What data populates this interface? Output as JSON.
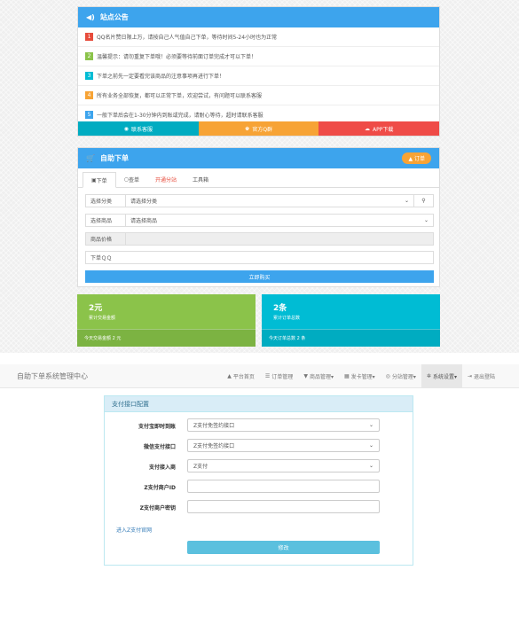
{
  "notice": {
    "title": "站点公告",
    "items": [
      {
        "num": "1",
        "color": "#e74c3c",
        "text": "QQ名片赞日限上万，请按自己人气值自己下单，等待时间5-24小时也为正常"
      },
      {
        "num": "2",
        "color": "#8bc34a",
        "text": "温馨提示：请勿重复下单哦！必须要等待前面订单完成才可以下单！"
      },
      {
        "num": "3",
        "color": "#00bcd4",
        "text": "下单之前先一定要看完该商品的注意事项再进行下单！"
      },
      {
        "num": "4",
        "color": "#f7a335",
        "text": "所有业务全部恢复，都可以正常下单，欢迎尝试，有问题可以联系客服"
      },
      {
        "num": "5",
        "color": "#3da4ed",
        "text": "一般下单后会在1-30分钟内到账或完成，请耐心等待，超时请联系客服"
      }
    ],
    "buttons": [
      {
        "label": "联系客服",
        "color": "#00acc1",
        "icon": "◉"
      },
      {
        "label": "官方Q群",
        "color": "#f7a335",
        "icon": "♚"
      },
      {
        "label": "APP下载",
        "color": "#ef4b47",
        "icon": "☁"
      }
    ]
  },
  "order": {
    "title": "自助下单",
    "badge": "订单",
    "tabs": [
      "下单",
      "查单",
      "开通分站",
      "工具箱"
    ],
    "category_label": "选择分类",
    "category_value": "请选择分类",
    "product_label": "选择商品",
    "product_value": "请选择商品",
    "price_label": "商品价格",
    "qq_label": "下单ＱＱ",
    "buy_label": "立即购买"
  },
  "stats": [
    {
      "big": "2元",
      "sub": "累计交易金额",
      "foot": "今天交易金额 2 元",
      "color": "#8bc34a",
      "footColor": "#7cb342"
    },
    {
      "big": "2条",
      "sub": "累计订单总数",
      "foot": "今天订单总数 2 条",
      "color": "#00bcd4",
      "footColor": "#00acc1"
    }
  ],
  "admin": {
    "brand": "自助下单系统管理中心",
    "nav": [
      {
        "icon": "▲",
        "label": "平台首页"
      },
      {
        "icon": "☰",
        "label": "订单管理"
      },
      {
        "icon": "▼",
        "label": "商品管理▾"
      },
      {
        "icon": "▦",
        "label": "发卡管理▾"
      },
      {
        "icon": "◎",
        "label": "分站管理▾"
      },
      {
        "icon": "✲",
        "label": "系统设置▾"
      },
      {
        "icon": "⇥",
        "label": "退出登陆"
      }
    ],
    "panel_title": "支付接口配置",
    "fields": [
      {
        "label": "支付宝即时到账",
        "value": "Z支付免签约接口",
        "type": "select"
      },
      {
        "label": "微信支付接口",
        "value": "Z支付免签约接口",
        "type": "select"
      },
      {
        "label": "支付接入商",
        "value": "Z支付",
        "type": "select"
      },
      {
        "label": "Z支付商户ID",
        "value": "",
        "type": "input"
      },
      {
        "label": "Z支付商户密钥",
        "value": "",
        "type": "input"
      }
    ],
    "link": "进入Z支付官网",
    "save": "修改"
  }
}
